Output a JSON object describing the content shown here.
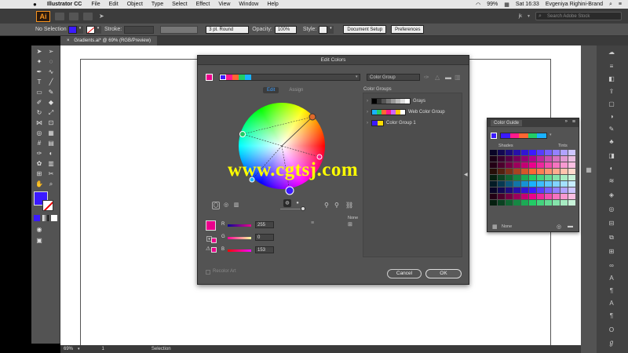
{
  "menubar": {
    "apple": "",
    "app_name": "Illustrator CC",
    "items": [
      "File",
      "Edit",
      "Object",
      "Type",
      "Select",
      "Effect",
      "View",
      "Window",
      "Help"
    ],
    "battery": "99%",
    "time": "Sat 16:33",
    "user": "Evgeniya Righini-Brand"
  },
  "appbar": {
    "logo": "Ai",
    "user_initials": "jk",
    "search_placeholder": "Search Adobe Stock"
  },
  "control_bar": {
    "selection_label": "No Selection",
    "stroke_label": "Stroke:",
    "brush": "3 pt. Round",
    "opacity_label": "Opacity:",
    "opacity_value": "100%",
    "style_label": "Style:",
    "document_setup": "Document Setup",
    "preferences": "Preferences",
    "fill_color": "#3b1aff"
  },
  "document": {
    "tab_title": "Gradients.ai* @ 69% (RGB/Preview)"
  },
  "status_bar": {
    "zoom": "69%",
    "artboard": "1",
    "tool": "Selection"
  },
  "edit_colors": {
    "title": "Edit Colors",
    "tab_edit": "Edit",
    "tab_assign": "Assign",
    "group_name": "Color Group",
    "color_groups_label": "Color Groups",
    "groups": [
      {
        "name": "Grays",
        "colors": [
          "#000000",
          "#333333",
          "#555555",
          "#777777",
          "#999999",
          "#bbbbbb",
          "#dddddd",
          "#ffffff"
        ]
      },
      {
        "name": "Web Color Group",
        "colors": [
          "#3b1aff",
          "#1ab1ff",
          "#22cc66",
          "#ff6633",
          "#ff1a8c",
          "#cc66ff",
          "#ffffff"
        ]
      },
      {
        "name": "Color Group 1",
        "colors": [
          "#3b1aff",
          "#ffdd00"
        ]
      }
    ],
    "active_swatch": "#ec008c",
    "r_label": "R",
    "g_label": "G",
    "b_label": "B",
    "r_value": "255",
    "g_value": "0",
    "b_value": "153",
    "none_label": "None",
    "recolor_art": "Recolor Art",
    "cancel": "Cancel",
    "ok": "OK",
    "header_swatches": [
      "#3b1aff",
      "#ff1a8c",
      "#ff6633",
      "#22cc66",
      "#1ab1ff"
    ]
  },
  "color_guide": {
    "title": "Color Guide",
    "shades": "Shades",
    "tints": "Tints",
    "none": "None",
    "top_swatches": [
      "#3b1aff",
      "#3b1aff",
      "#ff1a8c",
      "#ff6633",
      "#22cc66",
      "#1ab1ff"
    ]
  },
  "watermark": "www.cgtsj.com"
}
